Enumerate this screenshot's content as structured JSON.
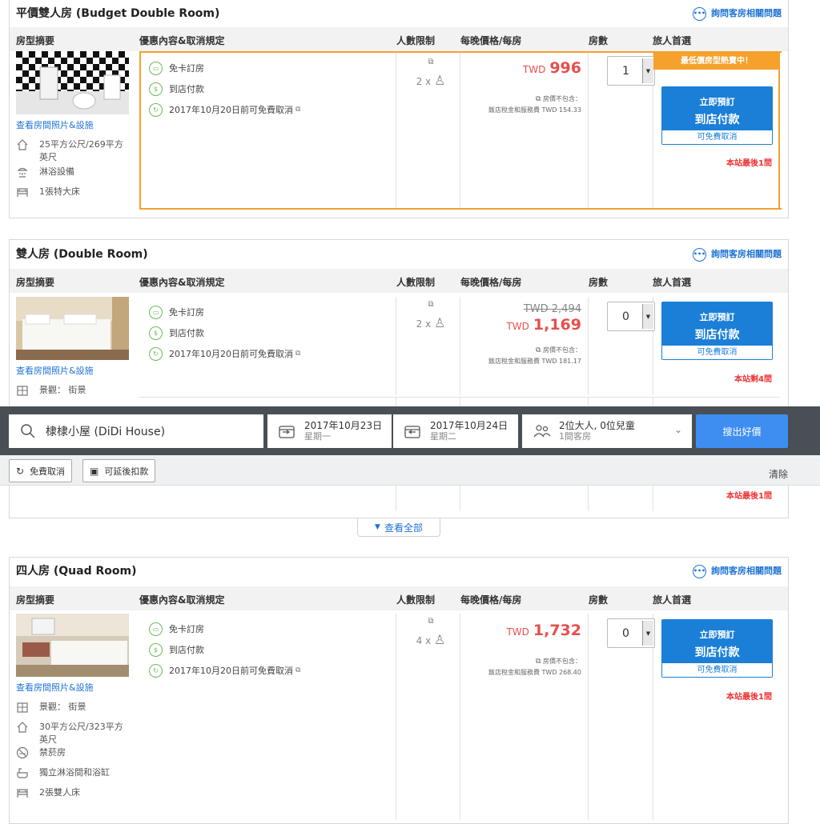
{
  "common": {
    "ask_label": "詢問客房相關問題",
    "headers": {
      "summary": "房型摘要",
      "deals": "優惠內容&取消規定",
      "occupancy": "人數限制",
      "price": "每晚價格/每房",
      "rooms": "房數",
      "choice": "旅人首選"
    },
    "photo_link": "查看房間照片&設施",
    "deal_no_card": "免卡訂房",
    "deal_pay_at_hotel": "到店付款",
    "deal_free_cancel": "2017年10月20日前可免費取消",
    "tax_line1": "房價不包含：",
    "book_line1": "立即預訂",
    "book_line2": "到店付款",
    "book_line3": "可免費取消"
  },
  "rooms": [
    {
      "title": "平價雙人房 (Budget Double Room)",
      "features": [
        "25平方公尺/269平方英尺",
        "淋浴設備",
        "1張特大床"
      ],
      "occupancy": "2 x",
      "currency": "TWD",
      "price": "996",
      "tax_line2": "飯店稅金和服務費 TWD 154.33",
      "qty": "1",
      "banner": "最低價房型熱賣中！",
      "availability": "本站最後1間"
    },
    {
      "title": "雙人房 (Double Room)",
      "features": [
        "景觀： 街景"
      ],
      "occupancy": "2 x",
      "currency": "TWD",
      "old_price": "TWD 2,494",
      "price": "1,169",
      "tax_line2": "飯店稅金和服務費 TWD 181.17",
      "qty": "0",
      "availability": "本站剩4間"
    },
    {
      "availability": "本站最後1間"
    },
    {
      "title": "四人房 (Quad Room)",
      "features": [
        "景觀： 街景",
        "30平方公尺/323平方英尺",
        "禁菸房",
        "獨立淋浴間和浴缸",
        "2張雙人床"
      ],
      "occupancy": "4 x",
      "currency": "TWD",
      "price": "1,732",
      "tax_line2": "飯店稅金和服務費 TWD 268.40",
      "qty": "0",
      "availability": "本站最後1間"
    }
  ],
  "view_all": "查看全部",
  "search": {
    "hotel": "棣棣小屋 (DiDi House)",
    "checkin_date": "2017年10月23日",
    "checkin_day": "星期一",
    "checkout_date": "2017年10月24日",
    "checkout_day": "星期二",
    "guests": "2位大人, 0位兒童",
    "rooms": "1間客房",
    "button": "搜出好價"
  },
  "filters": {
    "free_cancel": "免費取消",
    "pay_later": "可延後扣款",
    "clear": "清除"
  },
  "colors": {
    "accent": "#1b7fd8",
    "price": "#e94e4e",
    "banner": "#f5a12b",
    "searchbar": "#494f55"
  }
}
